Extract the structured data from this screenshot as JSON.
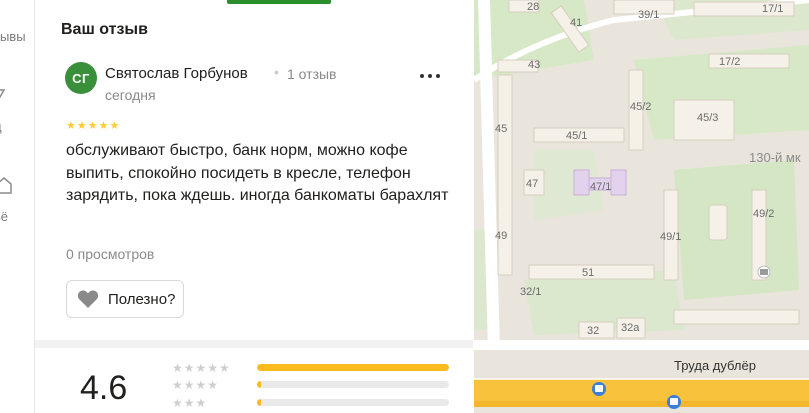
{
  "nav": {
    "items": [
      {
        "label": "зывы",
        "icon": "none"
      },
      {
        "label": "",
        "icon": "photo-icon"
      },
      {
        "label": "д",
        "icon": "none"
      },
      {
        "label": "",
        "icon": "home-icon"
      },
      {
        "label": "ьё",
        "icon": "none"
      }
    ]
  },
  "review": {
    "section_title": "Ваш отзыв",
    "avatar_initials": "СГ",
    "avatar_color": "#3a8f3a",
    "author": "Святослав Горбунов",
    "review_count": "1 отзыв",
    "date": "сегодня",
    "rating": 5,
    "text": "обслуживают быстро, банк норм, можно кофе выпить, спокойно посидеть в кресле, телефон зарядить, пока ждешь. иногда банкоматы барахлят",
    "views": "0 просмотров",
    "helpful_label": "Полезно?"
  },
  "summary": {
    "rating_value": "4.6",
    "distribution": [
      {
        "stars": 5,
        "share": 1.0
      },
      {
        "stars": 4,
        "share": 0.02
      },
      {
        "stars": 3,
        "share": 0.02
      }
    ]
  },
  "map": {
    "labels": [
      "28",
      "41",
      "39/1",
      "17/1",
      "43",
      "17/2",
      "45/2",
      "45",
      "45/1",
      "45/3",
      "130-й мк",
      "47",
      "47/1",
      "49",
      "49/1",
      "49/2",
      "51",
      "32/1",
      "32",
      "32а"
    ],
    "street": "Труда дублёр",
    "colors": {
      "road_main": "#f9c23c",
      "park": "#d7e8c6",
      "building": "#f5f1e8"
    }
  }
}
